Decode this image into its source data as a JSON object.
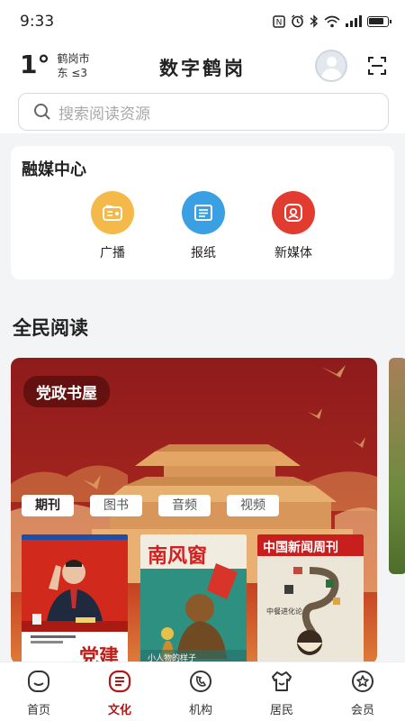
{
  "status_bar": {
    "time": "9:33",
    "icons": [
      "nfc-icon",
      "alarm-icon",
      "bluetooth-icon",
      "wifi-icon",
      "signal-icon",
      "battery-icon"
    ]
  },
  "header": {
    "temperature": "1°",
    "city": "鹤岗市",
    "wind": "东 ≤3",
    "app_title": "数字鹤岗"
  },
  "search": {
    "placeholder": "搜索阅读资源"
  },
  "media_center": {
    "title": "融媒中心",
    "items": [
      {
        "label": "广播",
        "color": "#f5b94a",
        "icon": "radio-icon"
      },
      {
        "label": "报纸",
        "color": "#3b9fe3",
        "icon": "newspaper-icon"
      },
      {
        "label": "新媒体",
        "color": "#e23b2f",
        "icon": "new-media-icon"
      }
    ]
  },
  "reading": {
    "title": "全民阅读",
    "banner_tag": "党政书屋",
    "tabs": [
      {
        "label": "期刊",
        "active": true
      },
      {
        "label": "图书",
        "active": false
      },
      {
        "label": "音频",
        "active": false
      },
      {
        "label": "视频",
        "active": false
      }
    ],
    "magazines": [
      {
        "title": "党建",
        "caption": ""
      },
      {
        "title": "南风窗",
        "caption": "小人物的样子"
      },
      {
        "title": "中国新闻周刊",
        "caption": "中餐进化论"
      }
    ]
  },
  "tab_bar": {
    "accent": "#b01818",
    "items": [
      {
        "label": "首页",
        "icon": "home-icon",
        "active": false
      },
      {
        "label": "文化",
        "icon": "culture-icon",
        "active": true
      },
      {
        "label": "机构",
        "icon": "institution-icon",
        "active": false
      },
      {
        "label": "居民",
        "icon": "resident-icon",
        "active": false
      },
      {
        "label": "会员",
        "icon": "member-icon",
        "active": false
      }
    ]
  }
}
